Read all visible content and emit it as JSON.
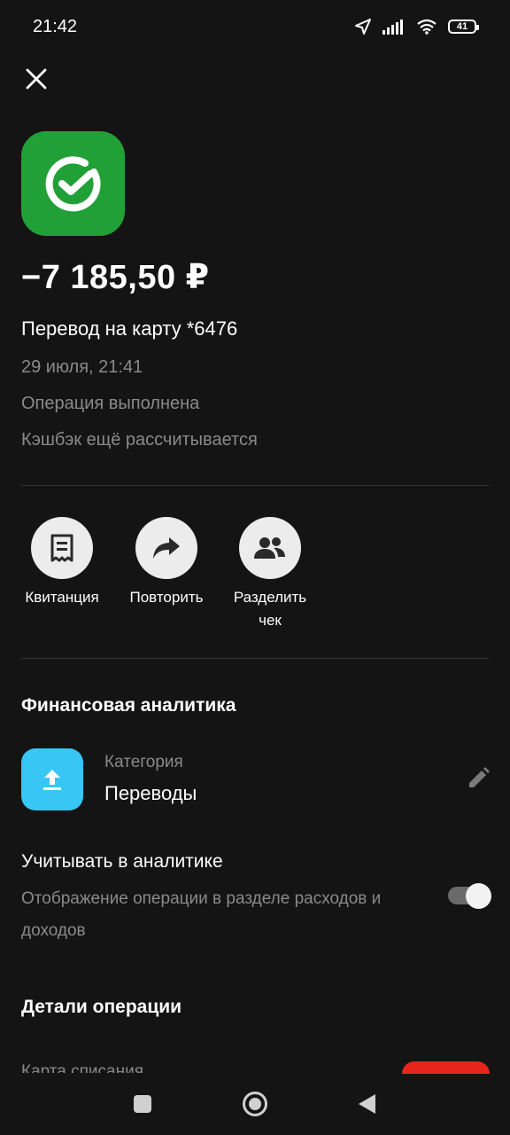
{
  "status_bar": {
    "time": "21:42",
    "battery": "41"
  },
  "transaction": {
    "amount": "−7 185,50 ₽",
    "description": "Перевод на карту *6476",
    "date": "29 июля, 21:41",
    "status": "Операция выполнена",
    "cashback": "Кэшбэк ещё рассчитывается"
  },
  "actions": [
    {
      "label": "Квитанция",
      "icon": "receipt-icon"
    },
    {
      "label": "Повторить",
      "icon": "repeat-icon"
    },
    {
      "label": "Разделить чек",
      "icon": "people-icon"
    }
  ],
  "analytics": {
    "title": "Финансовая аналитика",
    "category_label": "Категория",
    "category_value": "Переводы",
    "include_title": "Учитывать в аналитике",
    "include_desc": "Отображение операции в разделе расходов и доходов",
    "include_enabled": true
  },
  "details": {
    "title": "Детали операции",
    "card_label": "Карта списания"
  },
  "colors": {
    "background": "#141414",
    "brand_green": "#21a038",
    "category_blue": "#38c6f4",
    "card_red": "#e6261d"
  }
}
